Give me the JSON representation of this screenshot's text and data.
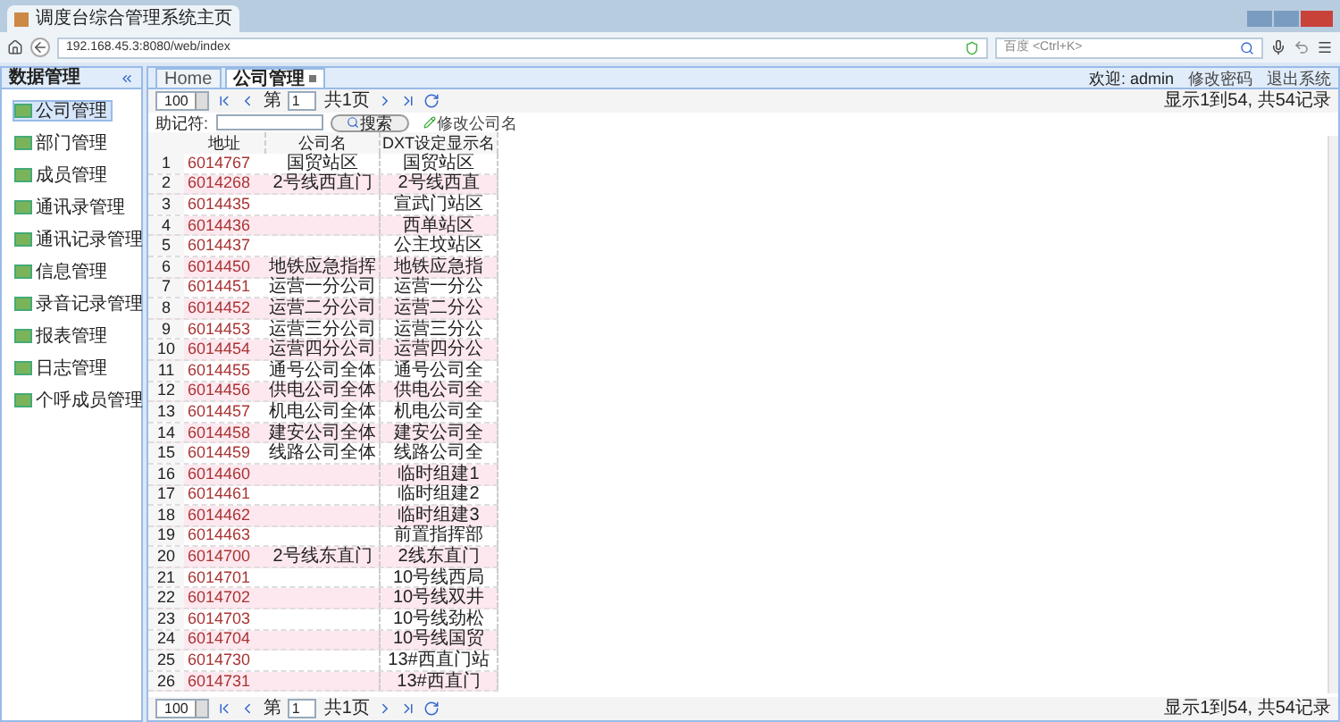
{
  "browser": {
    "tab_title": "调度台综合管理系统主页",
    "url": "192.168.45.3:8080/web/index",
    "search_placeholder": "百度 <Ctrl+K>"
  },
  "sidebar": {
    "title": "数据管理",
    "items": [
      {
        "label": "公司管理",
        "selected": true
      },
      {
        "label": "部门管理",
        "selected": false
      },
      {
        "label": "成员管理",
        "selected": false
      },
      {
        "label": "通讯录管理",
        "selected": false
      },
      {
        "label": "通讯记录管理",
        "selected": false
      },
      {
        "label": "信息管理",
        "selected": false
      },
      {
        "label": "录音记录管理",
        "selected": false
      },
      {
        "label": "报表管理",
        "selected": false
      },
      {
        "label": "日志管理",
        "selected": false
      },
      {
        "label": "个呼成员管理",
        "selected": false
      }
    ]
  },
  "tabs": [
    {
      "label": "Home",
      "selected": false,
      "closable": false
    },
    {
      "label": "公司管理",
      "selected": true,
      "closable": true
    }
  ],
  "user_bar": {
    "welcome": "欢迎: admin",
    "links": [
      "修改密码",
      "退出系统"
    ]
  },
  "pager_top": {
    "page_size": "100",
    "page_prefix": "第",
    "page": "1",
    "total_pages": "共1页",
    "summary": "显示1到54, 共54记录"
  },
  "search": {
    "label": "助记符:",
    "button": "搜索",
    "edit_button": "修改公司名"
  },
  "table": {
    "columns": [
      "",
      "地址",
      "公司名",
      "DXT设定显示名"
    ],
    "rows": [
      [
        "1",
        "6014767",
        "国贸站区",
        "国贸站区"
      ],
      [
        "2",
        "6014268",
        "2号线西直门",
        "2号线西直"
      ],
      [
        "3",
        "6014435",
        "",
        "宣武门站区"
      ],
      [
        "4",
        "6014436",
        "",
        "西单站区"
      ],
      [
        "5",
        "6014437",
        "",
        "公主坟站区"
      ],
      [
        "6",
        "6014450",
        "地铁应急指挥",
        "地铁应急指"
      ],
      [
        "7",
        "6014451",
        "运营一分公司",
        "运营一分公"
      ],
      [
        "8",
        "6014452",
        "运营二分公司",
        "运营二分公"
      ],
      [
        "9",
        "6014453",
        "运营三分公司",
        "运营三分公"
      ],
      [
        "10",
        "6014454",
        "运营四分公司",
        "运营四分公"
      ],
      [
        "11",
        "6014455",
        "通号公司全体",
        "通号公司全"
      ],
      [
        "12",
        "6014456",
        "供电公司全体",
        "供电公司全"
      ],
      [
        "13",
        "6014457",
        "机电公司全体",
        "机电公司全"
      ],
      [
        "14",
        "6014458",
        "建安公司全体",
        "建安公司全"
      ],
      [
        "15",
        "6014459",
        "线路公司全体",
        "线路公司全"
      ],
      [
        "16",
        "6014460",
        "",
        "临时组建1"
      ],
      [
        "17",
        "6014461",
        "",
        "临时组建2"
      ],
      [
        "18",
        "6014462",
        "",
        "临时组建3"
      ],
      [
        "19",
        "6014463",
        "",
        "前置指挥部"
      ],
      [
        "20",
        "6014700",
        "2号线东直门",
        "2线东直门"
      ],
      [
        "21",
        "6014701",
        "",
        "10号线西局"
      ],
      [
        "22",
        "6014702",
        "",
        "10号线双井"
      ],
      [
        "23",
        "6014703",
        "",
        "10号线劲松"
      ],
      [
        "24",
        "6014704",
        "",
        "10号线国贸"
      ],
      [
        "25",
        "6014730",
        "",
        "13#西直门站"
      ],
      [
        "26",
        "6014731",
        "",
        "13#西直门"
      ]
    ]
  },
  "pager_bottom": {
    "page_size": "100",
    "page_prefix": "第",
    "page": "1",
    "total_pages": "共1页",
    "summary": "显示1到54, 共54记录"
  }
}
